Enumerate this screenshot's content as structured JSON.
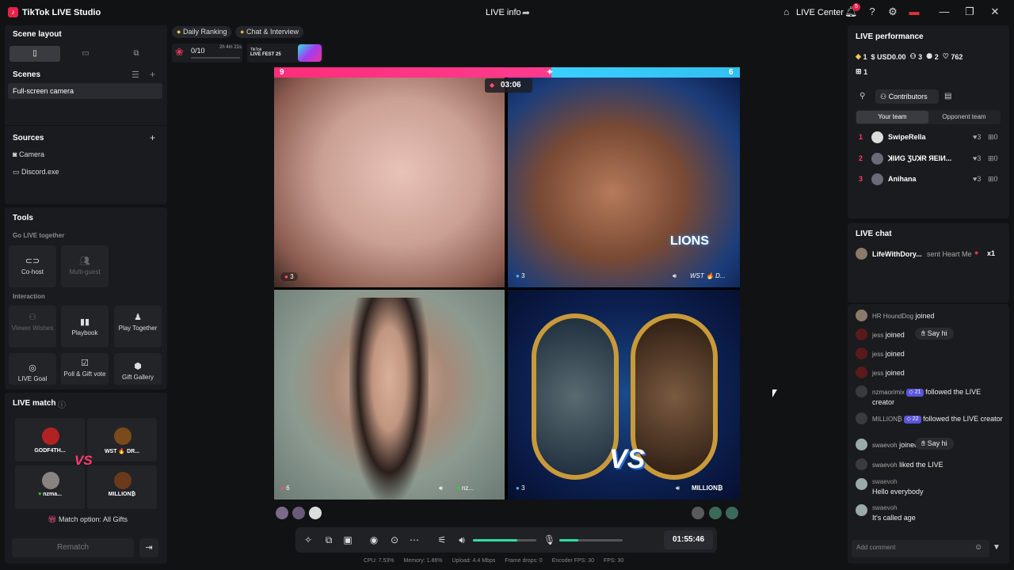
{
  "app": {
    "title": "TikTok LIVE Studio",
    "center_title": "LIVE info",
    "live_center": "LIVE Center",
    "notif_count": "5"
  },
  "left": {
    "scene_layout": "Scene layout",
    "scenes_title": "Scenes",
    "scene_item": "Full-screen camera",
    "sources_title": "Sources",
    "sources": [
      "Camera",
      "Discord.exe"
    ],
    "tools_title": "Tools",
    "go_live_together": "Go LIVE together",
    "cohost": "Co-host",
    "multiguest": "Multi-guest",
    "interaction": "Interaction",
    "viewer_wishes": "Viewer Wishes",
    "playbook": "Playbook",
    "play_together": "Play Together",
    "live_goal": "LIVE Goal",
    "poll": "Poll & Gift vote",
    "gift_gallery": "Gift Gallery",
    "live_match": "LIVE match",
    "players": [
      "GODF4TH...",
      "WST 🔥 DR...",
      "nzma...",
      "MILLION₿"
    ],
    "vs": "VS",
    "match_option": "Match option: All Gifts",
    "rematch": "Rematch"
  },
  "stage": {
    "chip1": "Daily Ranking",
    "chip2": "Chat & Interview",
    "progress": "0/10",
    "timer_small": "2h 4m 21s",
    "fest_line1": "TikTok",
    "fest_line2": "LIVE FEST 25",
    "score_left": "9",
    "score_right": "6",
    "countdown": "03:06",
    "tile_counts": [
      "3",
      "3",
      "6",
      "3"
    ],
    "tile_names": [
      "WST 🔥 D...",
      "nz...",
      "MILLION₿"
    ],
    "banner_text": "LIONS",
    "vs_text": "VS",
    "live_timer": "01:55:46",
    "volume_fill": 0.7,
    "mic_fill": 0.3
  },
  "stats": {
    "cpu": "CPU: 7.53%",
    "memory": "Memory: 1.86%",
    "upload": "Upload: 4.4 Mbps",
    "frame_drops": "Frame drops: 0",
    "encoder_fps": "Encoder FPS: 30",
    "fps": "FPS: 30"
  },
  "right": {
    "perf_title": "LIVE performance",
    "m_coins": "1",
    "m_usd": "USD0.00",
    "m_users": "3",
    "m_follow": "2",
    "m_likes": "762",
    "m_gift": "1",
    "contributors": "Contributors",
    "your_team": "Your team",
    "opponent_team": "Opponent team",
    "contrib": [
      {
        "rank": "1",
        "name": "SwipeRella",
        "likes": "3",
        "score": "0"
      },
      {
        "rank": "2",
        "name": "ꓘIИG ƷUꓘR ЯEIИ...",
        "likes": "3",
        "score": "0"
      },
      {
        "rank": "3",
        "name": "Anihana",
        "likes": "3",
        "score": "0"
      }
    ],
    "chat_title": "LIVE chat",
    "pinned_user": "LifeWithDory...",
    "pinned_text": "sent Heart Me",
    "pinned_count": "x1",
    "chat": [
      {
        "user": "HR HoundDog",
        "text": "joined"
      },
      {
        "user": "jess",
        "text": "joined",
        "sayhi": "Say hi"
      },
      {
        "user": "jess",
        "text": "joined"
      },
      {
        "user": "jess",
        "text": "joined"
      },
      {
        "user": "nzmaorimix",
        "level": "21",
        "text": "followed the LIVE creator"
      },
      {
        "user": "MILLION₿",
        "level": "22",
        "text": "followed the LIVE creator"
      },
      {
        "user": "swaevoh",
        "text": "joined",
        "sayhi": "Say hi"
      },
      {
        "user": "swaevoh",
        "text": "liked the LIVE"
      },
      {
        "user": "swaevoh",
        "text": "Hello everybody"
      },
      {
        "user": "swaevoh",
        "text": "It's called age"
      }
    ],
    "add_comment": "Add comment"
  }
}
